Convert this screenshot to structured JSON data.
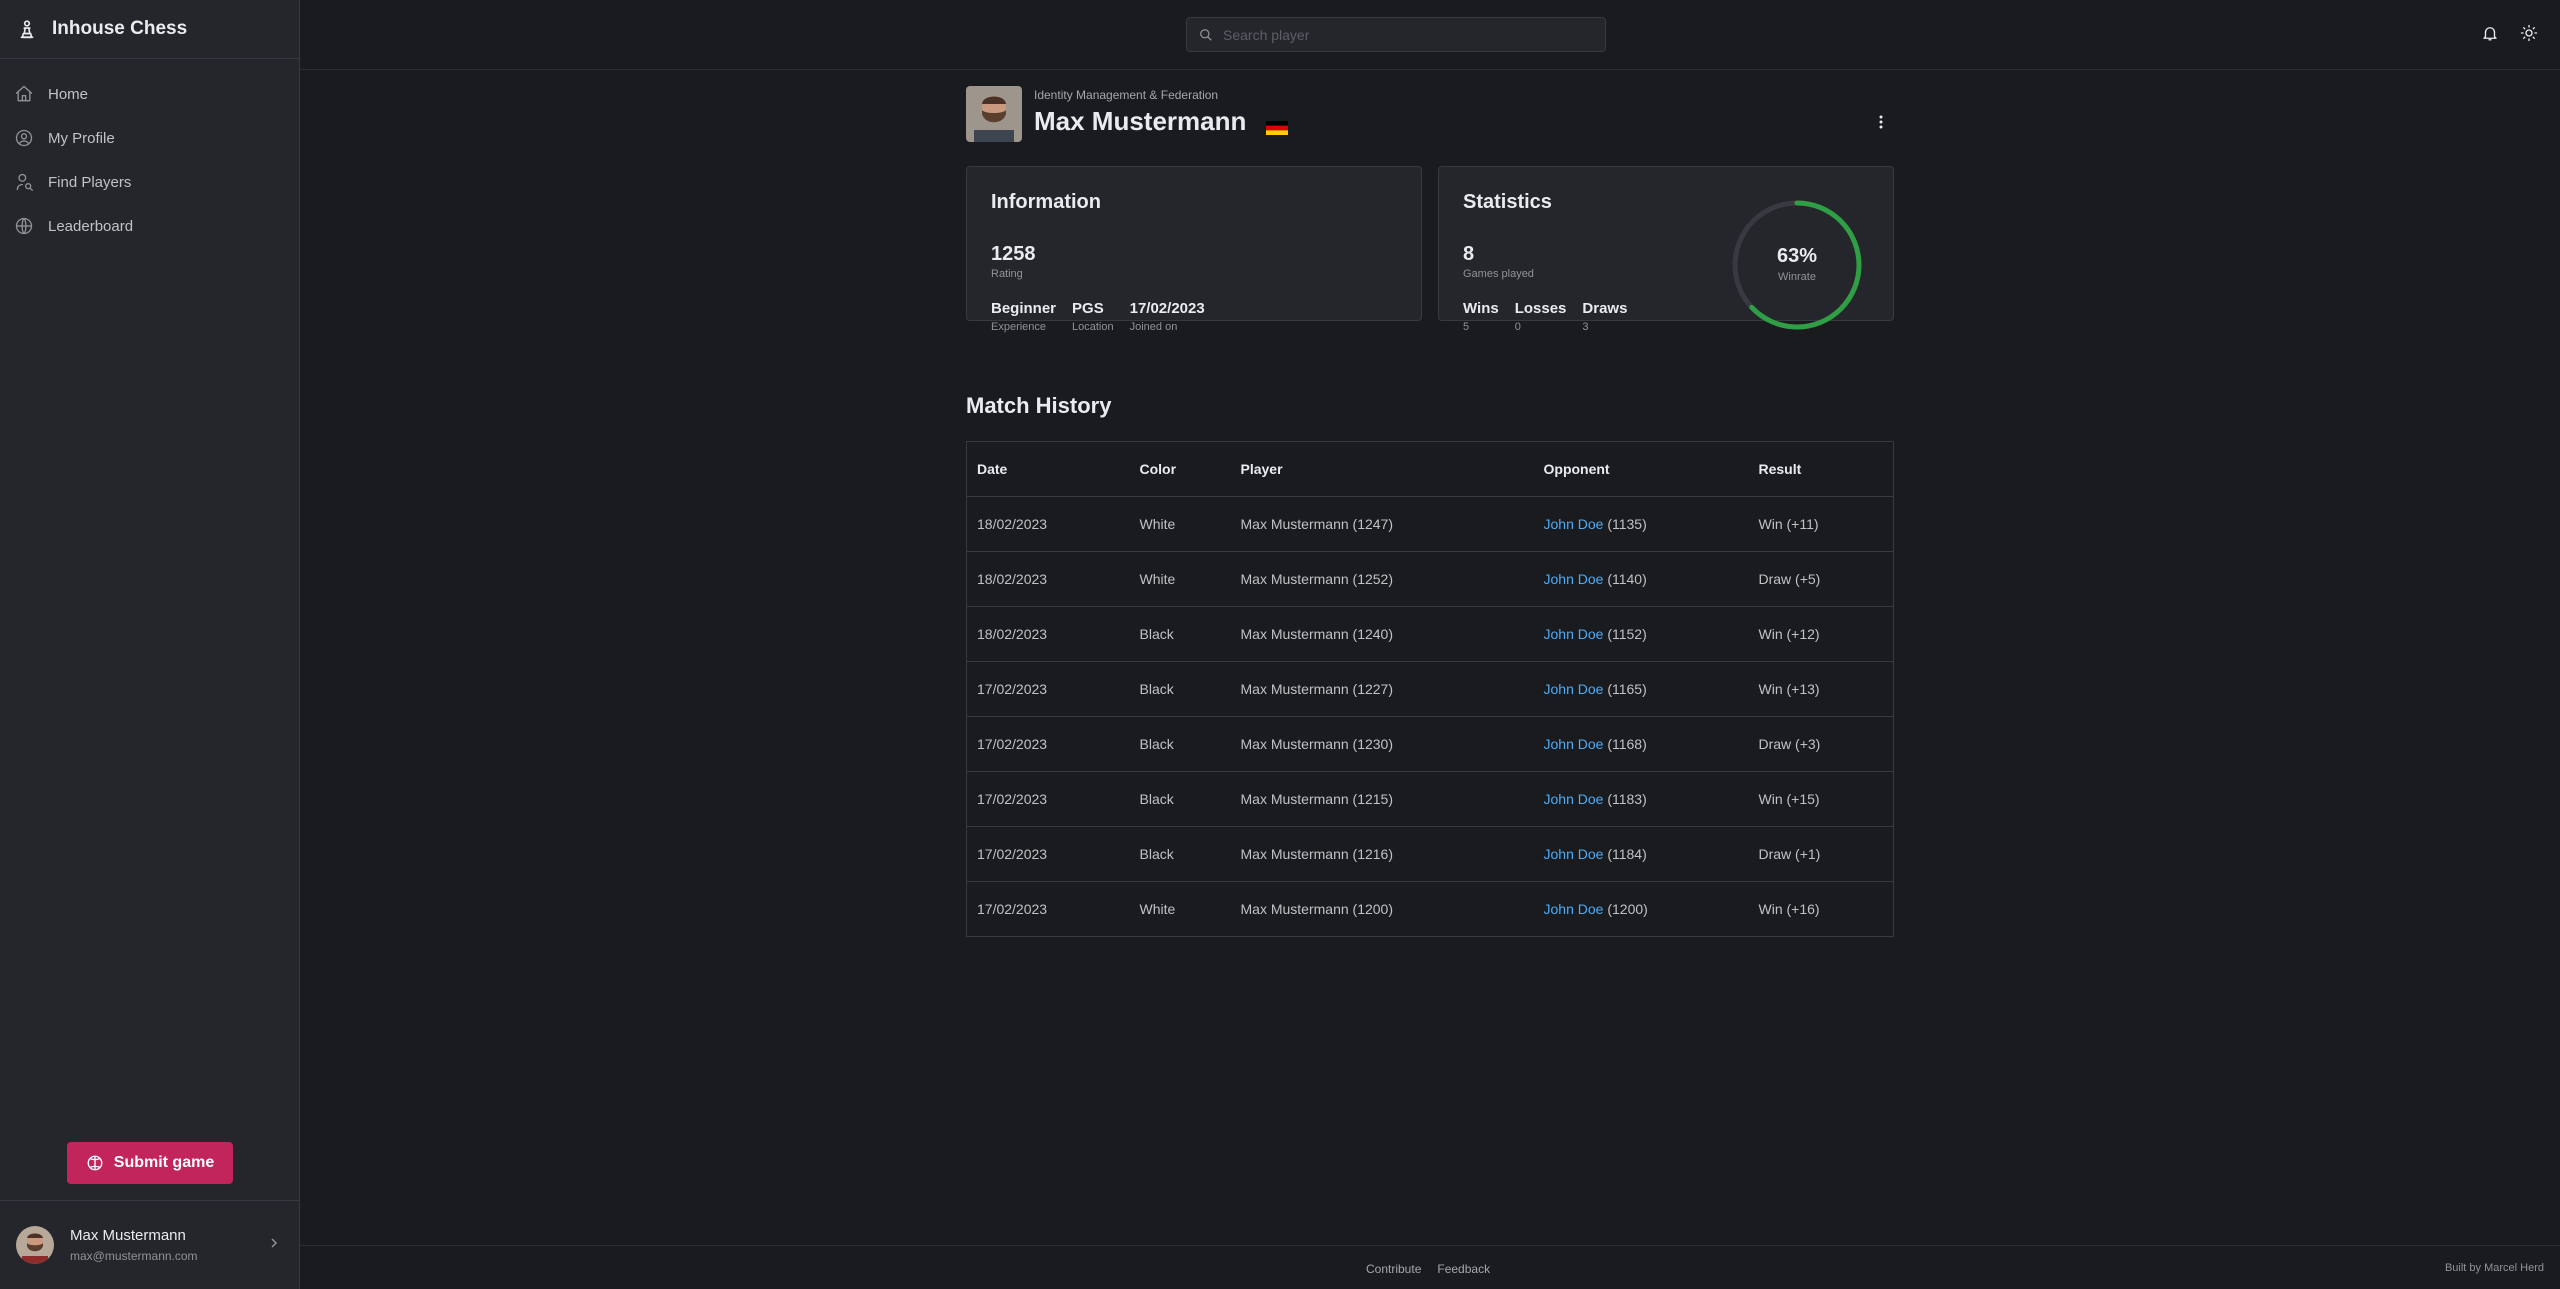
{
  "app": {
    "title": "Inhouse Chess"
  },
  "sidebar": {
    "items": [
      {
        "label": "Home",
        "icon": "home-icon"
      },
      {
        "label": "My Profile",
        "icon": "user-circle-icon"
      },
      {
        "label": "Find Players",
        "icon": "user-search-icon"
      },
      {
        "label": "Leaderboard",
        "icon": "globe-icon"
      }
    ],
    "submit_label": "Submit game",
    "user": {
      "name": "Max Mustermann",
      "email": "max@mustermann.com"
    }
  },
  "topbar": {
    "search_placeholder": "Search player"
  },
  "profile": {
    "organization": "Identity Management & Federation",
    "name": "Max Mustermann",
    "flag": "germany-flag-icon"
  },
  "information": {
    "title": "Information",
    "rating": "1258",
    "rating_label": "Rating",
    "experience": "Beginner",
    "experience_label": "Experience",
    "location": "PGS",
    "location_label": "Location",
    "joined": "17/02/2023",
    "joined_label": "Joined on"
  },
  "statistics": {
    "title": "Statistics",
    "games_played": "8",
    "games_played_label": "Games played",
    "wins_label": "Wins",
    "wins": "5",
    "losses_label": "Losses",
    "losses": "0",
    "draws_label": "Draws",
    "draws": "3",
    "winrate": "63%",
    "winrate_value": 0.63,
    "winrate_label": "Winrate",
    "ring_color": "#2f9e44"
  },
  "match_history": {
    "title": "Match History",
    "columns": [
      "Date",
      "Color",
      "Player",
      "Opponent",
      "Result"
    ],
    "rows": [
      {
        "date": "18/02/2023",
        "color": "White",
        "player": "Max Mustermann (1247)",
        "opponent": "John Doe",
        "opp_rating": "(1135)",
        "result": "Win (+11)"
      },
      {
        "date": "18/02/2023",
        "color": "White",
        "player": "Max Mustermann (1252)",
        "opponent": "John Doe",
        "opp_rating": "(1140)",
        "result": "Draw (+5)"
      },
      {
        "date": "18/02/2023",
        "color": "Black",
        "player": "Max Mustermann (1240)",
        "opponent": "John Doe",
        "opp_rating": "(1152)",
        "result": "Win (+12)"
      },
      {
        "date": "17/02/2023",
        "color": "Black",
        "player": "Max Mustermann (1227)",
        "opponent": "John Doe",
        "opp_rating": "(1165)",
        "result": "Win (+13)"
      },
      {
        "date": "17/02/2023",
        "color": "Black",
        "player": "Max Mustermann (1230)",
        "opponent": "John Doe",
        "opp_rating": "(1168)",
        "result": "Draw (+3)"
      },
      {
        "date": "17/02/2023",
        "color": "Black",
        "player": "Max Mustermann (1215)",
        "opponent": "John Doe",
        "opp_rating": "(1183)",
        "result": "Win (+15)"
      },
      {
        "date": "17/02/2023",
        "color": "Black",
        "player": "Max Mustermann (1216)",
        "opponent": "John Doe",
        "opp_rating": "(1184)",
        "result": "Draw (+1)"
      },
      {
        "date": "17/02/2023",
        "color": "White",
        "player": "Max Mustermann (1200)",
        "opponent": "John Doe",
        "opp_rating": "(1200)",
        "result": "Win (+16)"
      }
    ]
  },
  "footer": {
    "links": [
      "Contribute",
      "Feedback"
    ],
    "built_by": "Built by Marcel Herd"
  }
}
